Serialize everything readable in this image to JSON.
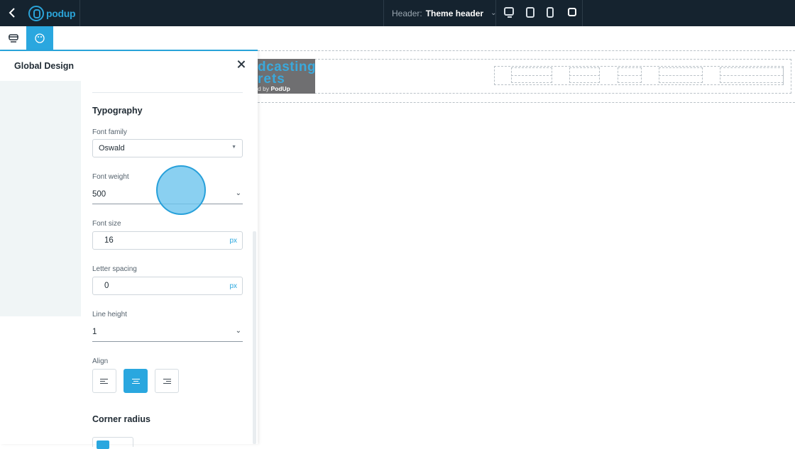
{
  "topbar": {
    "logo_text": "podup",
    "header_label": "Header:",
    "header_value": "Theme header",
    "devices": [
      "desktop-icon",
      "tablet-icon",
      "mobile-icon",
      "fullscreen-icon"
    ]
  },
  "panel": {
    "title": "Global Design",
    "typography": {
      "title": "Typography",
      "font_family_label": "Font family",
      "font_family_value": "Oswald",
      "font_weight_label": "Font weight",
      "font_weight_value": "500",
      "font_size_label": "Font size",
      "font_size_value": "16",
      "font_size_unit": "px",
      "letter_spacing_label": "Letter spacing",
      "letter_spacing_value": "0",
      "letter_spacing_unit": "px",
      "line_height_label": "Line height",
      "line_height_value": "1",
      "align_label": "Align",
      "align_options": [
        "left",
        "center",
        "right"
      ],
      "align_selected": "center"
    },
    "corner_radius": {
      "title": "Corner radius"
    }
  },
  "canvas": {
    "brand_line1": "dcasting",
    "brand_line2": "rets",
    "brand_line3_prefix": "d by",
    "brand_line3_name": "PodUp"
  },
  "colors": {
    "topbar_bg": "#15232f",
    "accent": "#2aa7df",
    "panel_side_bg": "#f0f5f6"
  }
}
